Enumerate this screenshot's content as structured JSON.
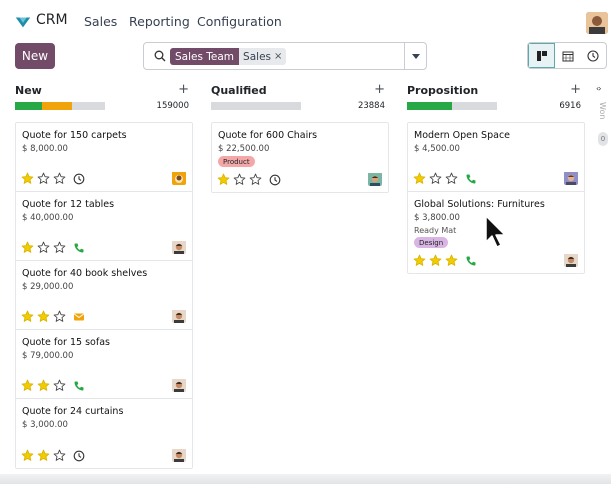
{
  "nav": {
    "app_name": "CRM",
    "menu": [
      "Sales",
      "Reporting",
      "Configuration"
    ]
  },
  "control": {
    "new_label": "New",
    "facet_label": "Sales Team",
    "facet_value": "Sales"
  },
  "columns": [
    {
      "title": "New",
      "total": "159000",
      "progress": {
        "green": 0.3,
        "orange": 0.33
      },
      "cards": [
        {
          "name": "Quote for 150 carpets",
          "amount": "$ 8,000.00",
          "stars": 1,
          "activity": "clock-icon"
        },
        {
          "name": "Quote for 12 tables",
          "amount": "$ 40,000.00",
          "stars": 1,
          "activity": "phone-icon"
        },
        {
          "name": "Quote for 40 book shelves",
          "amount": "$ 29,000.00",
          "stars": 2,
          "activity": "envelope-icon"
        },
        {
          "name": "Quote for 15 sofas",
          "amount": "$ 79,000.00",
          "stars": 2,
          "activity": "phone-icon"
        },
        {
          "name": "Quote for 24 curtains",
          "amount": "$ 3,000.00",
          "stars": 2,
          "activity": "clock-icon"
        }
      ]
    },
    {
      "title": "Qualified",
      "total": "23884",
      "progress": {
        "green": 0,
        "orange": 0
      },
      "cards": [
        {
          "name": "Quote for 600 Chairs",
          "amount": "$ 22,500.00",
          "tag": "Product",
          "stars": 1,
          "activity": "clock-icon"
        }
      ]
    },
    {
      "title": "Proposition",
      "total": "6916",
      "progress": {
        "green": 0.5,
        "orange": 0
      },
      "cards": [
        {
          "name": "Modern Open Space",
          "amount": "$ 4,500.00",
          "stars": 1,
          "activity": "phone-icon"
        },
        {
          "name": "Global Solutions: Furnitures",
          "amount": "$ 3,800.00",
          "sub": "Ready Mat",
          "tag": "Design",
          "stars": 3,
          "activity": "phone-icon"
        }
      ]
    }
  ],
  "folded": {
    "title": "Won",
    "count": "0"
  },
  "colors": {
    "brand": "#714b67",
    "progress_green": "#28a745",
    "progress_orange": "#f0a30a",
    "tag_product": "#f4a7a7",
    "tag_design": "#d9b5e3",
    "star": "#f3cc00"
  }
}
